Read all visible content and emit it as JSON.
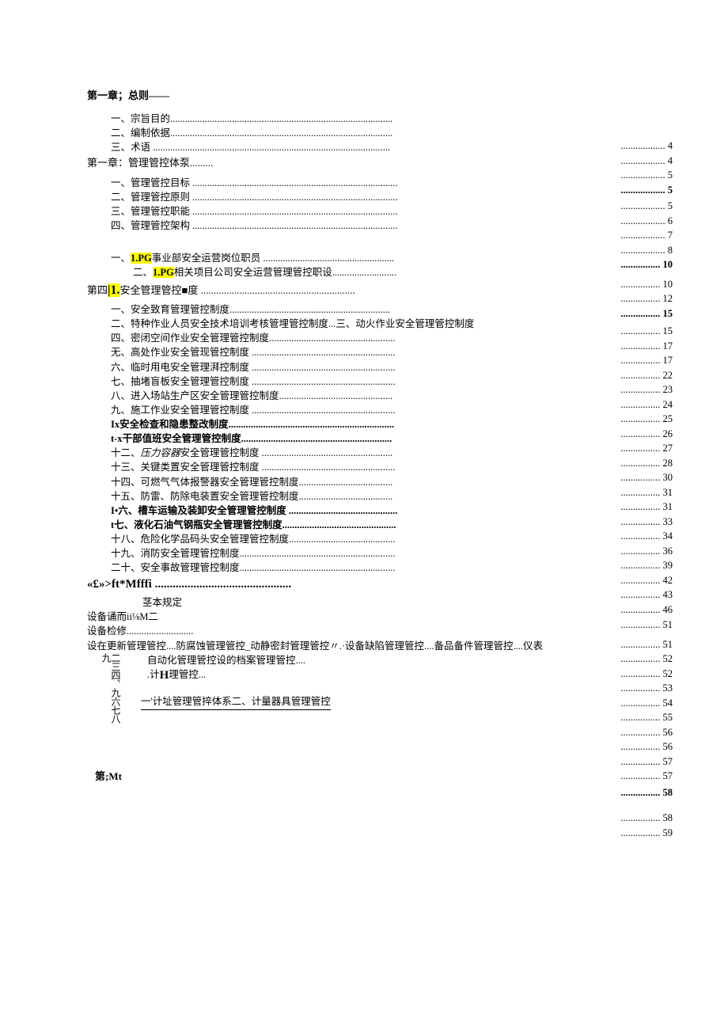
{
  "headings": {
    "ch1a": "第一章；总则——",
    "ch1b": "第一章：管理管控体泵.........",
    "ch4_pre": "第四",
    "ch4_hl": "|1.",
    "ch4_post": "安全管理管控■度 ............................................................",
    "ft": "«£»>ft*Mfffi ..............................................",
    "mt": "第;Mt"
  },
  "lines": {
    "l1": "一、宗旨目的..........................................................................................",
    "l2": "二、编制依据..........................................................................................",
    "l3": "三、术语 ................................................................................................",
    "l4": "一、管理管控目标 ...................................................................................",
    "l5": "二、管理管控原则 ...................................................................................",
    "l6": "三、管理管控职能 ...................................................................................",
    "l7": "四、管理管控架构 ...................................................................................",
    "l8a": "一、",
    "l8hl": "1.PG",
    "l8b": "事业部安全运营岗位职员 .....................................................",
    "l9a": "二、",
    "l9hl": "1.PG",
    "l9b": "相关项目公司安全运营管理管控职设..........................",
    "l10": "一、安全致育管理管控制度.................................................................",
    "l11": "二、特种作业人员安全技术培训考核管埋管控制度...三、动火作业安全管理管控制度",
    "l12": "四、密闭空间作业安全管理管控制度...................................................",
    "l13": "无、高处作业安全管现管控制度 ..........................................................",
    "l14": "六、临时用电安全管理湃控制度 ..........................................................",
    "l15": "七、抽堵盲板安全管理管控制度 ..........................................................",
    "l16": "八、进入场站生产区安全管理管控制度..............................................",
    "l17": "九、施工作业安全管理管控制度 ..........................................................",
    "l18": "Ix安全检查和隐患整改制度...................................................................",
    "l19": "t-x干部值班安全管理管控制度.............................................................",
    "l20a": "十二、",
    "l20i": "压力容器",
    "l20b": "安全管理管控制度 .....................................................",
    "l21": "十三、关键类置安全管理管控制度 ......................................................",
    "l22": "十四、可燃气气体报警器安全管理管控制度......................................",
    "l23": "十五、防雷、防除电装置安全管理管控制度......................................",
    "l24": "I•六、槽车运输及装卸安全管理管控制度 ............................................",
    "l25": "t七、液化石油气钢瓶安全管理管控制度..............................................",
    "l26": "十八、危险化学品码头安全管理管控制度...........................................",
    "l27": "十九、消防安全管理管控制度...............................................................",
    "l28": "二十、安全事故管理管控制度...............................................................",
    "l29": "茎本规定",
    "l30": "设备诵而ii⅛M二",
    "l31": "设备检修...........................",
    "l32": "设在更新管理管控....防腐蚀管理管控_动静密封管理管控〃.·设备缺陷管理管控....备品备件管理管控....仪表",
    "l33": "自动化管理管控设的档案管理管控....",
    "l34a": ".计",
    "l34h": "H",
    "l34b": "理管控...",
    "l35": "一'计址管理管捽体系二、计量器具管理管控",
    "vert": "二三四、九六七八九",
    "vert2": ""
  },
  "pages": [
    ".................. 4",
    ".................. 4",
    ".................. 5",
    ".................. 5",
    ".................. 5",
    ".................. 6",
    ".................. 7",
    ".................. 8",
    "................ 10",
    "................ 10",
    "................ 12",
    "................ 15",
    "................ 15",
    "................ 17",
    "................ 17",
    "................ 22",
    "................ 23",
    "................ 24",
    "................ 25",
    "................ 26",
    "................ 27",
    "................ 28",
    "................ 30",
    "................ 31",
    "................ 31",
    "................ 33",
    "................ 34",
    "................ 36",
    "................ 39",
    "................ 42",
    "................ 43",
    "................ 46",
    "................ 51",
    "................ 51",
    "................ 52",
    "................ 52",
    "................ 53",
    "................ 54",
    "................ 55",
    "................ 56",
    "................ 56",
    "................ 57",
    "................ 57",
    "................ 58",
    "................ 58",
    "................ 59"
  ],
  "bold_pages": [
    3,
    8,
    11,
    43
  ]
}
